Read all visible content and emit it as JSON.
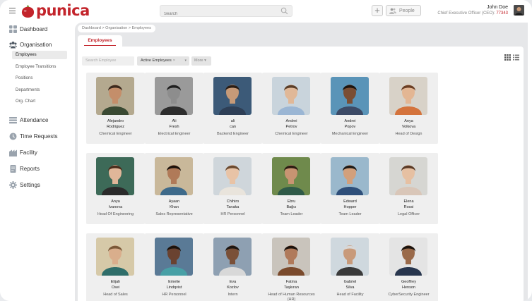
{
  "brand": {
    "name": "punica",
    "color": "#c3242b"
  },
  "header": {
    "search_placeholder": "Search",
    "plus_label": "+",
    "people_label": "People",
    "user_name": "John Doe",
    "user_role": "Chief Executive Officer (CEO):",
    "user_id": "77343"
  },
  "sidebar": {
    "dashboard": "Dashboard",
    "organisation": "Organisation",
    "sub_items": [
      "Employees",
      "Employee Transitions",
      "Positions",
      "Departments",
      "Org. Chart"
    ],
    "attendance": "Attendance",
    "time_requests": "Time Requests",
    "facility": "Facility",
    "reports": "Reports",
    "settings": "Settings"
  },
  "breadcrumb": "Dashboard  >  Organisation  >  Employees",
  "tab": "Employees",
  "filters": {
    "search_placeholder": "Search Employee",
    "status": "Active Employees",
    "status_clear": "×",
    "status_dropdown": "▾",
    "more": "More",
    "more_dropdown": "▾"
  },
  "employees": [
    {
      "first": "Alejandro",
      "last": "Rodriguez",
      "title": "Chemical Engineer",
      "bg": "#b4a98f",
      "skin": "#c48e6a",
      "shirt": "#3a4a33",
      "hair": "#3b2a1e"
    },
    {
      "first": "Ali",
      "last": "Fresh",
      "title": "Electrical Engineer",
      "bg": "#9a9a9a",
      "skin": "#8d8d8d",
      "shirt": "#2d2d2d",
      "hair": "#1f1f1f"
    },
    {
      "first": "ali",
      "last": "can",
      "title": "Backend Engineer",
      "bg": "#3c5a78",
      "skin": "#c69a78",
      "shirt": "#2e3f56",
      "hair": "#2a1d14"
    },
    {
      "first": "Andrei",
      "last": "Petrov",
      "title": "Chemical Engineer",
      "bg": "#c9d4dc",
      "skin": "#e0b898",
      "shirt": "#9bb6d4",
      "hair": "#5a3e28"
    },
    {
      "first": "Andrei",
      "last": "Popov",
      "title": "Mechanical Engineer",
      "bg": "#5a94b8",
      "skin": "#7a4e34",
      "shirt": "#3c4a66",
      "hair": "#1d140e"
    },
    {
      "first": "Anya",
      "last": "Volkova",
      "title": "Head of Design",
      "bg": "#d8d2c8",
      "skin": "#e3b693",
      "shirt": "#d4733c",
      "hair": "#6a3e24"
    },
    {
      "first": "Anya",
      "last": "Ivanova",
      "title": "Head Of Engineering",
      "bg": "#3d6a58",
      "skin": "#e0b699",
      "shirt": "#2b2b2b",
      "hair": "#4a2d1c"
    },
    {
      "first": "Ayaan",
      "last": "Khan",
      "title": "Sales Representative",
      "bg": "#c9b89a",
      "skin": "#b07a58",
      "shirt": "#3e6a8a",
      "hair": "#1c120c"
    },
    {
      "first": "Chihiro",
      "last": "Tanaka",
      "title": "HR Personnel",
      "bg": "#cfd6db",
      "skin": "#e8c3a6",
      "shirt": "#e9e4dc",
      "hair": "#6a4a30"
    },
    {
      "first": "Ebru",
      "last": "Bağcı",
      "title": "Team Leader",
      "bg": "#6f8a4c",
      "skin": "#c89472",
      "shirt": "#2f5a48",
      "hair": "#2c1c12"
    },
    {
      "first": "Edward",
      "last": "Hopper",
      "title": "Team Leader",
      "bg": "#9ab8cc",
      "skin": "#d2a07c",
      "shirt": "#2e4f7a",
      "hair": "#1e1a16"
    },
    {
      "first": "Elena",
      "last": "Rossi",
      "title": "Legal Officer",
      "bg": "#d6d6d2",
      "skin": "#e6c0a2",
      "shirt": "#d9c6b8",
      "hair": "#5a3a26"
    },
    {
      "first": "Elijah",
      "last": "Osei",
      "title": "Head of Sales",
      "bg": "#d6c9a8",
      "skin": "#d9ae8c",
      "shirt": "#2f6e6a",
      "hair": "#7a5838"
    },
    {
      "first": "Emelie",
      "last": "Lindqvist",
      "title": "HR Personnel",
      "bg": "#5a7a96",
      "skin": "#6a4230",
      "shirt": "#48a0a6",
      "hair": "#1b120c"
    },
    {
      "first": "Eva",
      "last": "Kozlov",
      "title": "Intern",
      "bg": "#8ea0b2",
      "skin": "#7a5038",
      "shirt": "#d8d8d8",
      "hair": "#1d1612"
    },
    {
      "first": "Fatma",
      "last": "Taşkıran",
      "title": "Head of Human Resources (HR)",
      "bg": "#c9c4bc",
      "skin": "#b07a5a",
      "shirt": "#7a4a2c",
      "hair": "#1c120c"
    },
    {
      "first": "Gabriel",
      "last": "Silva",
      "title": "Head of Facility",
      "bg": "#cfd8de",
      "skin": "#c89a7a",
      "shirt": "#3a3a3a",
      "hair": "#d8d8d8"
    },
    {
      "first": "Geoffrey",
      "last": "Henson",
      "title": "CyberSecurity Engineer",
      "bg": "#e4e4e4",
      "skin": "#9a6a4a",
      "shirt": "#28364e",
      "hair": "#1a120c"
    }
  ]
}
